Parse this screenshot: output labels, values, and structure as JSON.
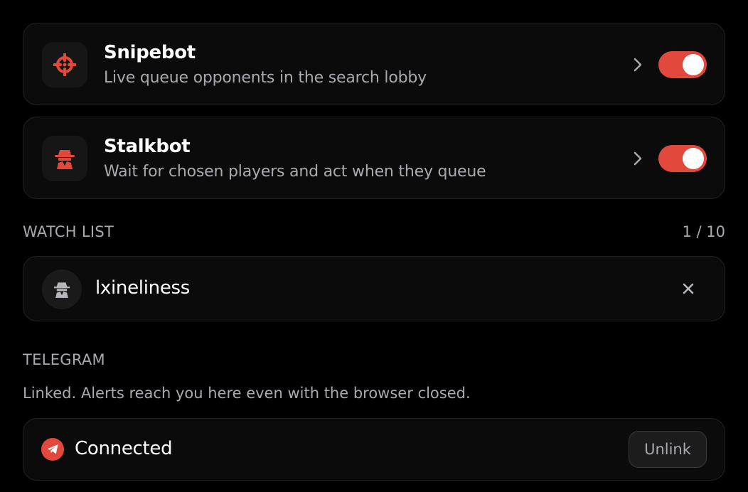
{
  "features": {
    "snipebot": {
      "title": "Snipebot",
      "description": "Live queue opponents in the search lobby",
      "icon": "crosshair-icon",
      "enabled": true
    },
    "stalkbot": {
      "title": "Stalkbot",
      "description": "Wait for chosen players and act when they queue",
      "icon": "spy-icon",
      "enabled": true
    }
  },
  "watch_list": {
    "label": "WATCH LIST",
    "count": "1 / 10",
    "items": [
      {
        "name": "lxineliness",
        "icon": "spy-icon"
      }
    ]
  },
  "telegram": {
    "label": "TELEGRAM",
    "description": "Linked. Alerts reach you here even with the browser closed.",
    "status": "Connected",
    "icon": "telegram-icon",
    "unlink_label": "Unlink"
  },
  "colors": {
    "accent": "#e2483b",
    "background": "#000000",
    "card": "#0b0b0b",
    "muted_text": "#a9a9b0"
  }
}
